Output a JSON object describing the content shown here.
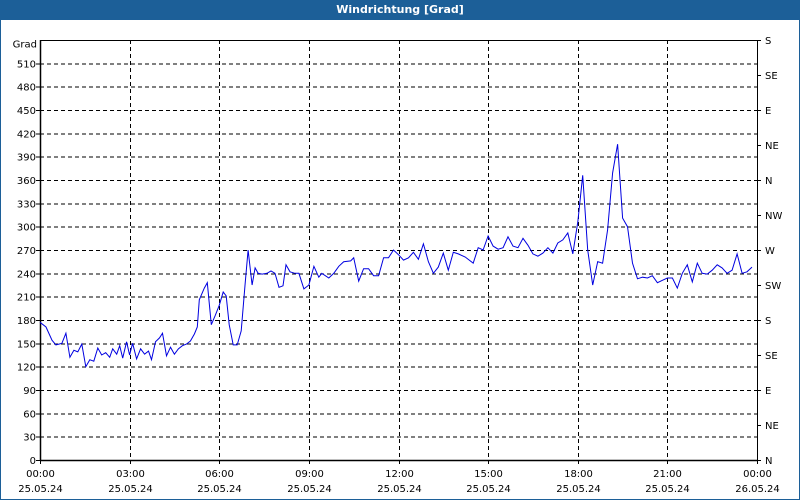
{
  "title": "Windrichtung [Grad]",
  "chart_data": {
    "type": "line",
    "title": "Windrichtung [Grad]",
    "ylabel": "Grad",
    "ylim": [
      0,
      540
    ],
    "yticks": [
      0,
      30,
      60,
      90,
      120,
      150,
      180,
      210,
      240,
      270,
      300,
      330,
      360,
      390,
      420,
      450,
      480,
      510
    ],
    "right_ticks": [
      {
        "value": 0,
        "label": "N"
      },
      {
        "value": 45,
        "label": "NE"
      },
      {
        "value": 90,
        "label": "E"
      },
      {
        "value": 135,
        "label": "SE"
      },
      {
        "value": 180,
        "label": "S"
      },
      {
        "value": 225,
        "label": "SW"
      },
      {
        "value": 270,
        "label": "W"
      },
      {
        "value": 315,
        "label": "NW"
      },
      {
        "value": 360,
        "label": "N"
      },
      {
        "value": 405,
        "label": "NE"
      },
      {
        "value": 450,
        "label": "E"
      },
      {
        "value": 495,
        "label": "SE"
      },
      {
        "value": 540,
        "label": "S"
      }
    ],
    "xlim_minutes": [
      0,
      1440
    ],
    "xticks": [
      {
        "minute": 0,
        "time": "00:00",
        "date": "25.05.24"
      },
      {
        "minute": 180,
        "time": "03:00",
        "date": "25.05.24"
      },
      {
        "minute": 360,
        "time": "06:00",
        "date": "25.05.24"
      },
      {
        "minute": 540,
        "time": "09:00",
        "date": "25.05.24"
      },
      {
        "minute": 720,
        "time": "12:00",
        "date": "25.05.24"
      },
      {
        "minute": 900,
        "time": "15:00",
        "date": "25.05.24"
      },
      {
        "minute": 1080,
        "time": "18:00",
        "date": "25.05.24"
      },
      {
        "minute": 1260,
        "time": "21:00",
        "date": "25.05.24"
      },
      {
        "minute": 1440,
        "time": "00:00",
        "date": "26.05.24"
      }
    ],
    "grid": true,
    "line_color": "#0000e0",
    "series": [
      {
        "name": "Windrichtung",
        "x_minutes": [
          0,
          12,
          24,
          32,
          44,
          52,
          60,
          68,
          76,
          84,
          92,
          100,
          108,
          116,
          124,
          132,
          140,
          146,
          154,
          160,
          166,
          174,
          180,
          186,
          194,
          202,
          210,
          218,
          224,
          232,
          240,
          246,
          254,
          262,
          270,
          278,
          286,
          294,
          302,
          310,
          316,
          320,
          330,
          336,
          344,
          352,
          360,
          368,
          374,
          380,
          388,
          396,
          404,
          412,
          418,
          426,
          432,
          438,
          446,
          456,
          464,
          472,
          480,
          488,
          494,
          502,
          512,
          520,
          530,
          540,
          550,
          560,
          566,
          580,
          590,
          600,
          610,
          624,
          630,
          640,
          650,
          660,
          670,
          680,
          690,
          700,
          710,
          720,
          730,
          740,
          750,
          760,
          770,
          780,
          790,
          800,
          810,
          820,
          830,
          840,
          854,
          870,
          880,
          890,
          900,
          910,
          920,
          930,
          940,
          950,
          960,
          970,
          980,
          990,
          1000,
          1010,
          1020,
          1030,
          1040,
          1050,
          1060,
          1070,
          1080,
          1090,
          1100,
          1110,
          1120,
          1130,
          1140,
          1150,
          1160,
          1170,
          1180,
          1190,
          1200,
          1210,
          1220,
          1230,
          1240,
          1250,
          1260,
          1270,
          1280,
          1290,
          1300,
          1310,
          1320,
          1330,
          1340,
          1350,
          1360,
          1370,
          1380,
          1390,
          1400,
          1410,
          1420,
          1430
        ],
        "values": [
          177,
          171,
          154,
          148,
          150,
          163,
          132,
          141,
          139,
          149,
          120,
          129,
          127,
          144,
          135,
          138,
          132,
          143,
          136,
          147,
          131,
          152,
          135,
          150,
          130,
          143,
          136,
          140,
          129,
          152,
          157,
          163,
          134,
          145,
          136,
          143,
          147,
          149,
          153,
          162,
          171,
          206,
          221,
          228,
          174,
          186,
          199,
          216,
          211,
          174,
          148,
          148,
          166,
          226,
          270,
          225,
          247,
          240,
          239,
          240,
          243,
          240,
          222,
          224,
          251,
          242,
          240,
          240,
          220,
          225,
          249,
          235,
          240,
          234,
          240,
          249,
          255,
          256,
          260,
          230,
          246,
          246,
          237,
          237,
          260,
          260,
          270,
          264,
          257,
          260,
          267,
          258,
          278,
          255,
          240,
          248,
          266,
          244,
          267,
          265,
          261,
          253,
          273,
          270,
          288,
          275,
          271,
          273,
          287,
          275,
          273,
          285,
          276,
          265,
          262,
          266,
          273,
          266,
          279,
          283,
          292,
          265,
          306,
          366,
          270,
          225,
          255,
          253,
          296,
          369,
          406,
          311,
          300,
          253,
          233,
          235,
          234,
          237,
          228,
          231,
          234,
          234,
          221,
          240,
          251,
          229,
          253,
          240,
          239,
          244,
          251,
          247,
          240,
          244,
          265,
          240,
          242,
          248
        ]
      }
    ]
  }
}
